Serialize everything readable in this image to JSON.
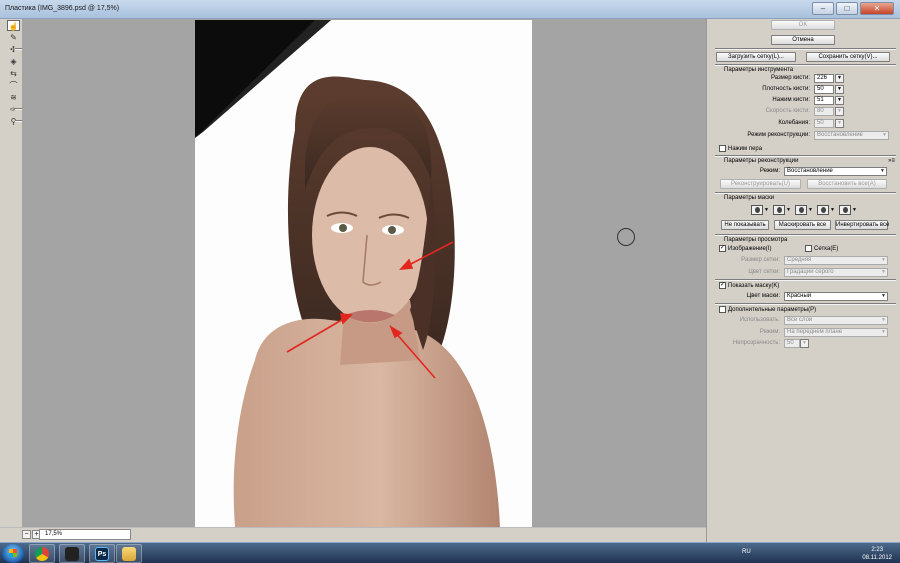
{
  "window": {
    "title": "Пластика (IMG_3896.psd @ 17,5%)",
    "minimize": "–",
    "maximize": "□",
    "close": "✕"
  },
  "status": {
    "zoom": "17,5%",
    "zoom_out": "−",
    "zoom_in": "+"
  },
  "panel": {
    "ok": "OK",
    "cancel": "Отмена",
    "load_mesh": "Загрузить сетку(L)...",
    "save_mesh": "Сохранить сетку(V)...",
    "tool_options": {
      "heading": "Параметры инструмента",
      "brush_size_label": "Размер кисти:",
      "brush_size": "226",
      "brush_density_label": "Плотность кисти:",
      "brush_density": "50",
      "brush_pressure_label": "Нажим кисти:",
      "brush_pressure": "51",
      "brush_rate_label": "Скорость кисти:",
      "brush_rate": "80",
      "turbulence_label": "Колебания:",
      "turbulence": "50",
      "reconstruct_mode_label": "Режим реконструкции:",
      "reconstruct_mode": "Восстановление",
      "stylus_pressure": "Нажим пера"
    },
    "reconstruct_options": {
      "heading": "Параметры реконструкции",
      "mode_label": "Режим:",
      "mode": "Восстановление",
      "reconstruct_button": "Реконструировать(U)",
      "restore_all_button": "Восстановить все(A)"
    },
    "mask_options": {
      "heading": "Параметры маски",
      "none_button": "Не показывать",
      "mask_all_button": "Маскировать все",
      "invert_all_button": "Инвертировать все"
    },
    "view_options": {
      "heading": "Параметры просмотра",
      "show_image": "Изображение(I)",
      "show_mesh": "Сетка(E)",
      "mesh_size_label": "Размер сетки:",
      "mesh_size": "Средняя",
      "mesh_color_label": "Цвет сетки:",
      "mesh_color": "Градации серого",
      "show_mask": "Показать маску(K)",
      "mask_color_label": "Цвет маски:",
      "mask_color": "Красный"
    },
    "backdrop": {
      "heading": "Дополнительные параметры(P)",
      "use_label": "Использовать:",
      "use": "Все слои",
      "mode_label": "Режим:",
      "mode": "На переднем плане",
      "opacity_label": "Непрозрачность:",
      "opacity": "50"
    },
    "checkmark": "✓",
    "expand": "»≡"
  },
  "taskbar": {
    "lang": "RU",
    "time": "2:23",
    "date": "08.11.2012",
    "ps_label": "Ps"
  },
  "colors": {
    "arrow": "#e3261f",
    "taskbar": "#1f3350"
  }
}
